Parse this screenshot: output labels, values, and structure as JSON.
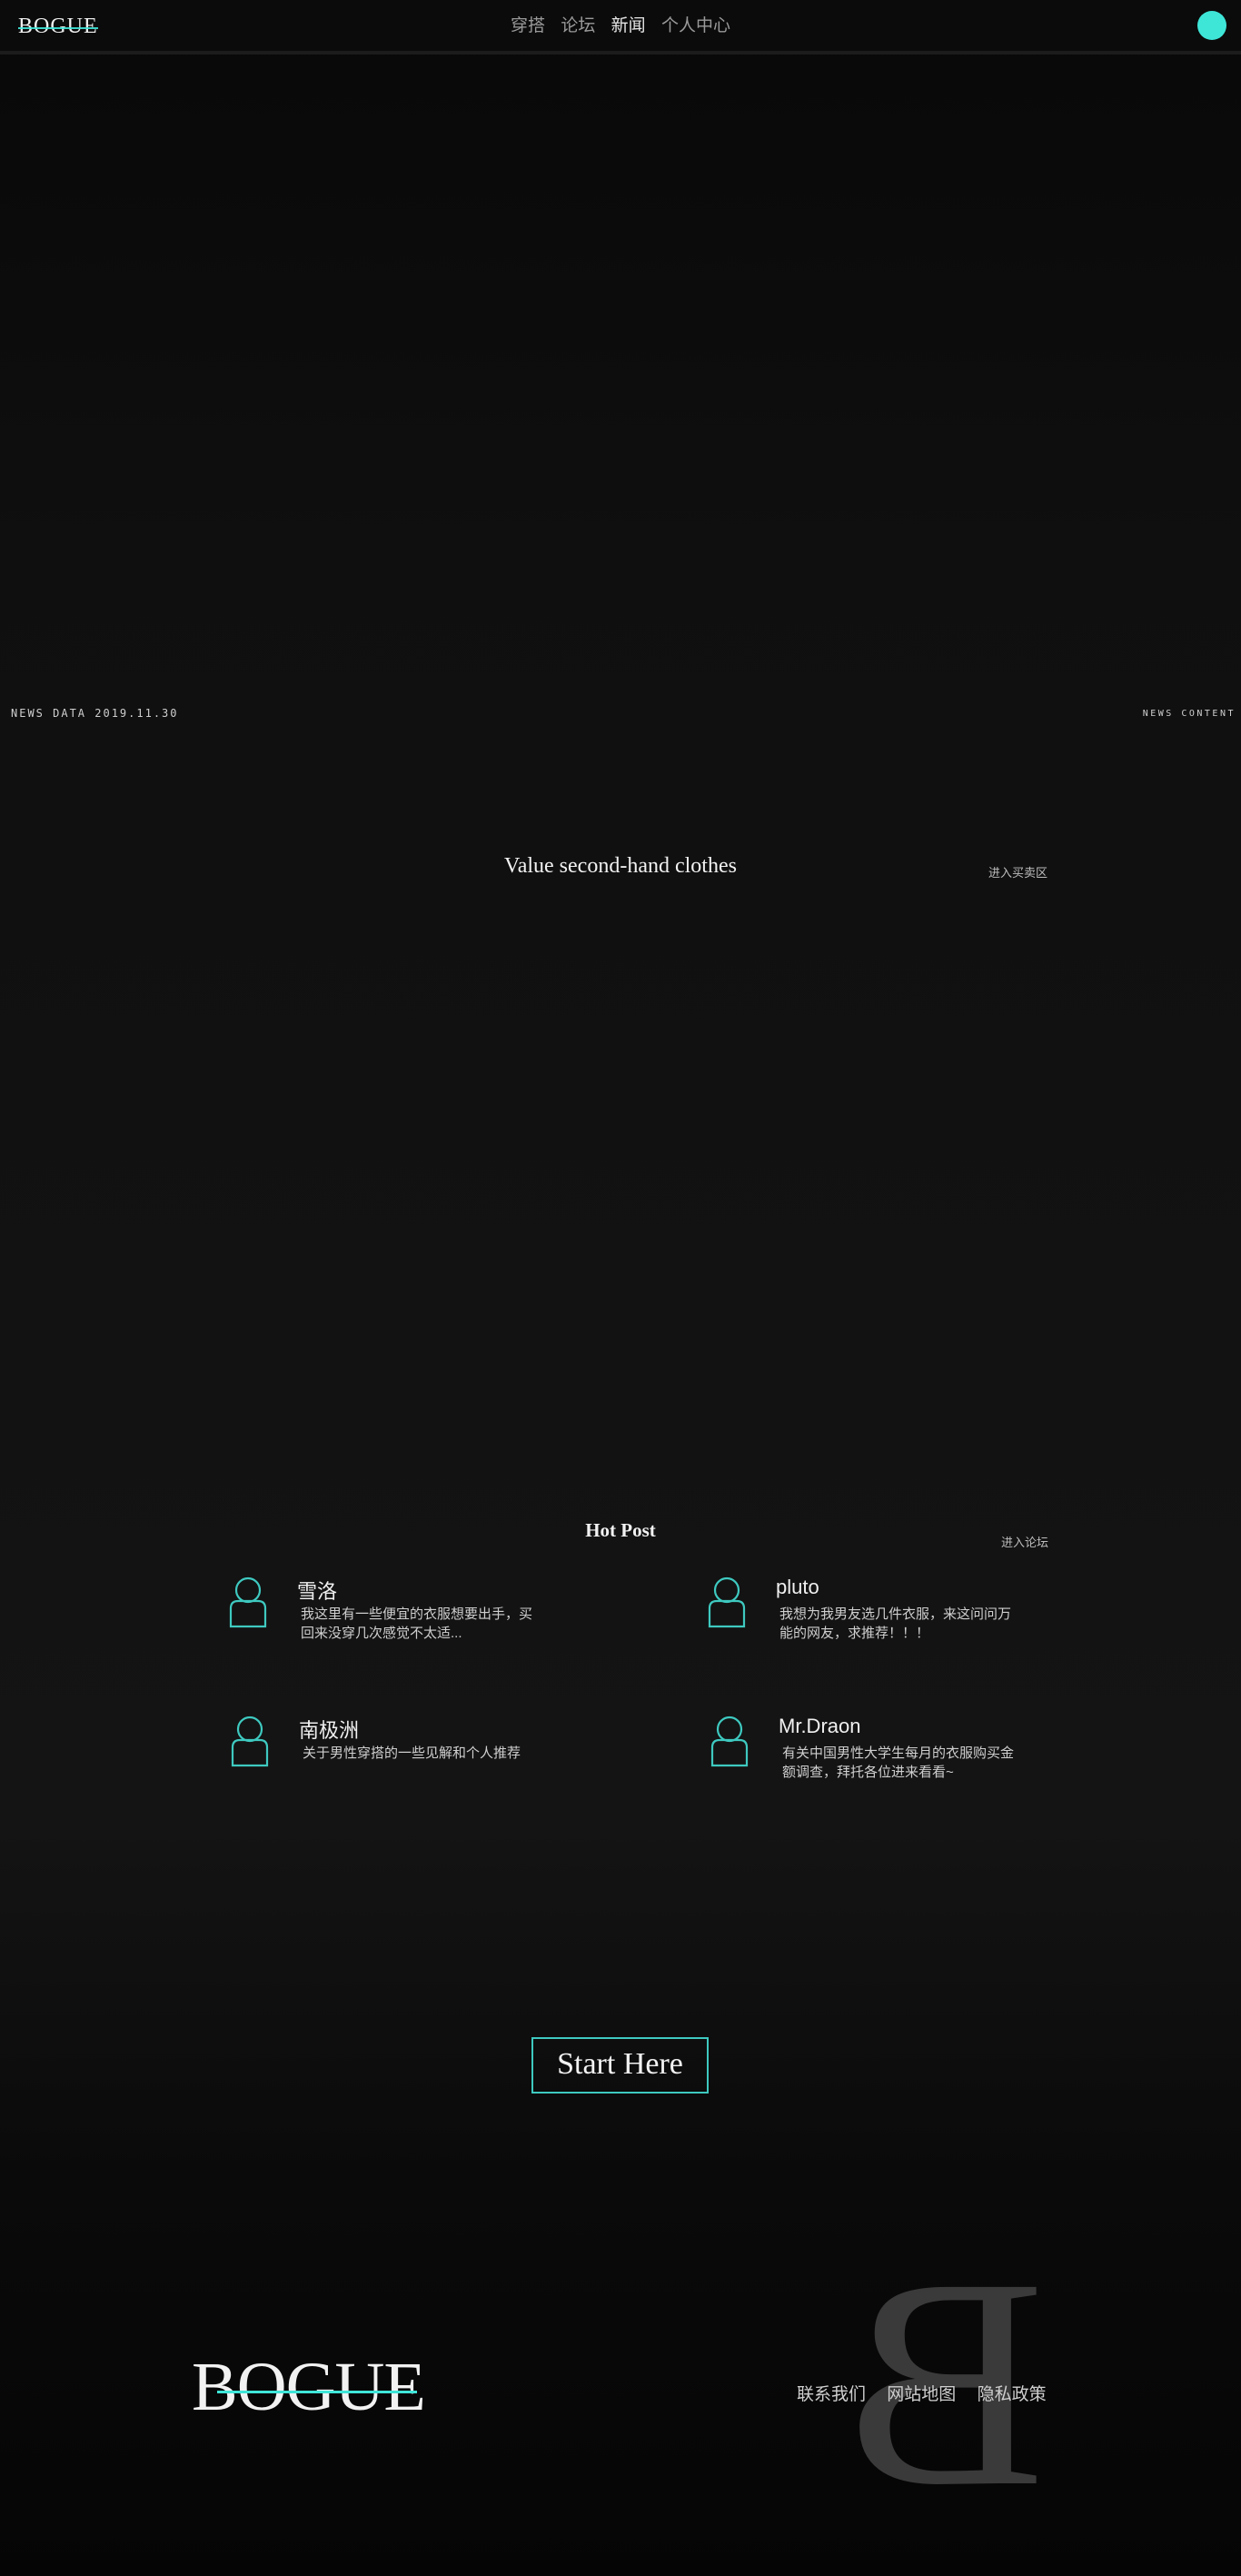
{
  "header": {
    "logo_text": "BOGUE",
    "nav": [
      {
        "label": "穿搭"
      },
      {
        "label": "论坛"
      },
      {
        "label": "新闻"
      },
      {
        "label": "个人中心"
      }
    ],
    "accent_color": "#3ee6d8"
  },
  "news": {
    "data_label": "NEWS DATA 2019.11.30",
    "content_label": "NEWS CONTENT"
  },
  "market": {
    "title": "Value second-hand clothes",
    "link_label": "进入买卖区"
  },
  "hot_post": {
    "title": "Hot Post",
    "link_label": "进入论坛",
    "posts": [
      {
        "name": "雪洛",
        "text": "我这里有一些便宜的衣服想要出手，买回来没穿几次感觉不太适...",
        "icon": "user-icon"
      },
      {
        "name": "pluto",
        "text": "我想为我男友选几件衣服，来这问问万能的网友，求推荐！！！",
        "icon": "user-icon"
      },
      {
        "name": "南极洲",
        "text": "关于男性穿搭的一些见解和个人推荐",
        "icon": "user-icon"
      },
      {
        "name": "Mr.Draon",
        "text": "有关中国男性大学生每月的衣服购买金额调查，拜托各位进来看看~",
        "icon": "user-icon"
      }
    ]
  },
  "cta": {
    "label": "Start Here"
  },
  "footer": {
    "logo_text": "BOGUE",
    "watermark": "B",
    "links": [
      {
        "label": "联系我们"
      },
      {
        "label": "网站地图"
      },
      {
        "label": "隐私政策"
      }
    ]
  }
}
